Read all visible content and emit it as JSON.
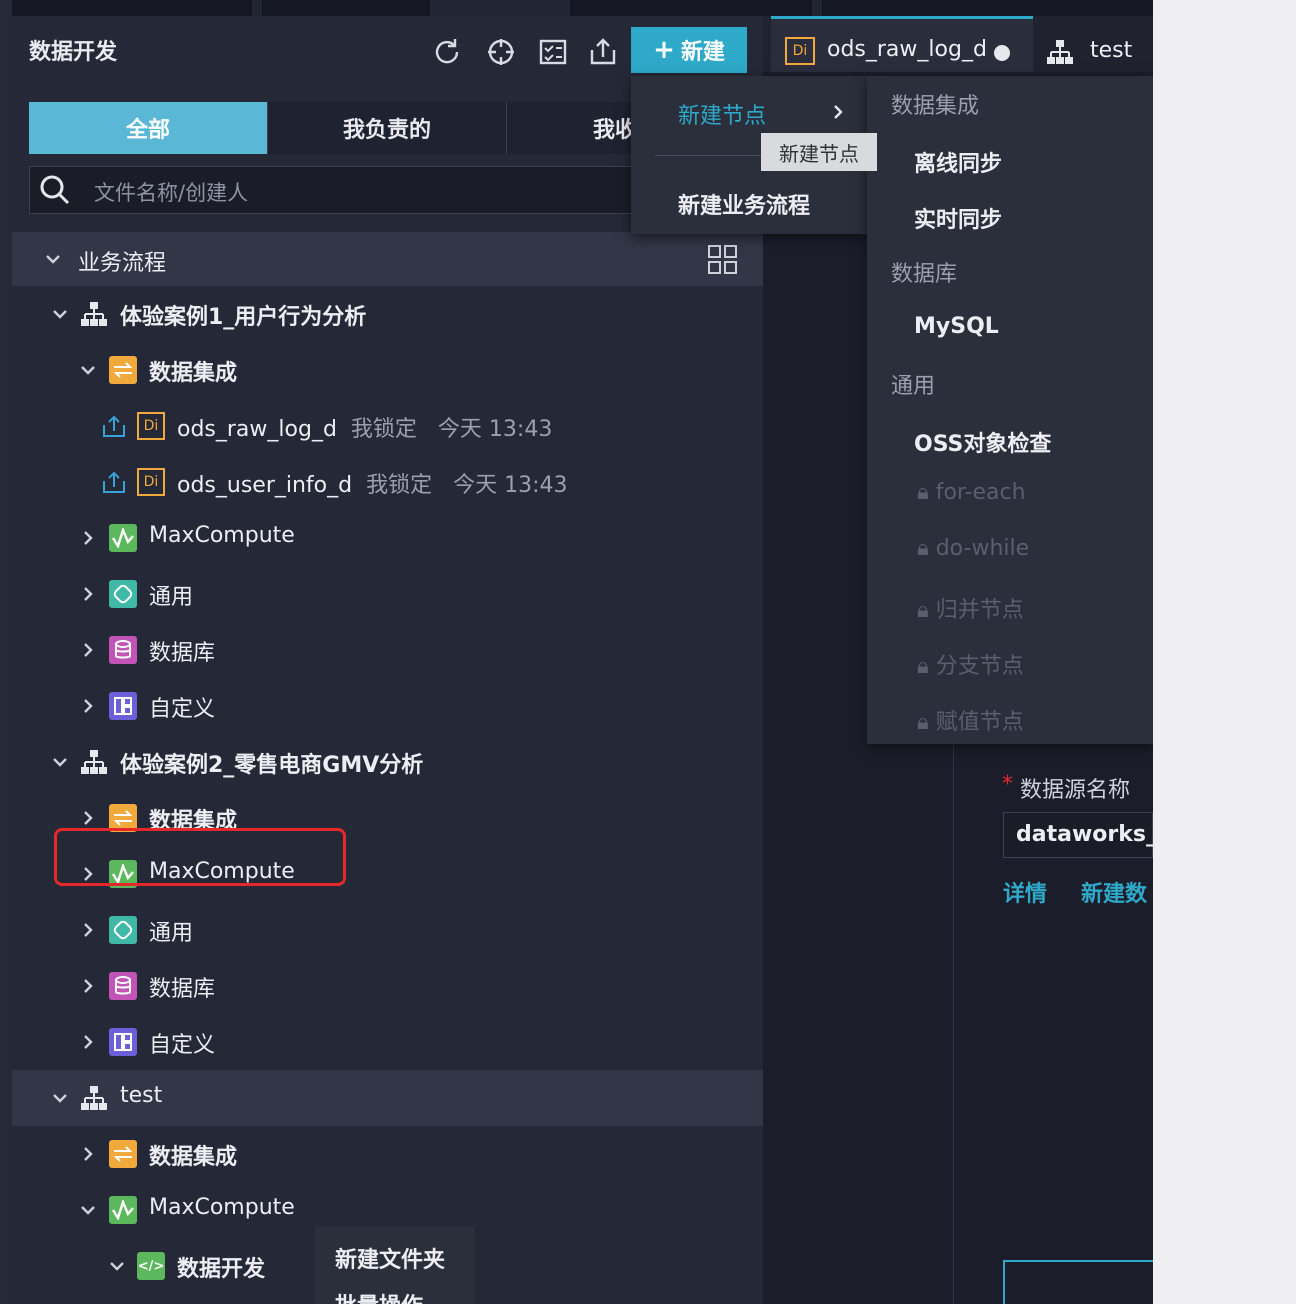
{
  "header": {
    "title": "数据开发",
    "new_label": "新建"
  },
  "tabs": [
    "全部",
    "我负责的",
    "我收藏"
  ],
  "search": {
    "placeholder": "文件名称/创建人"
  },
  "tree": {
    "section_label": "业务流程",
    "flow1": {
      "name": "体验案例1_用户行为分析",
      "integration": "数据集成",
      "files": [
        {
          "name": "ods_raw_log_d",
          "lock": "我锁定",
          "time": "今天 13:43"
        },
        {
          "name": "ods_user_info_d",
          "lock": "我锁定",
          "time": "今天 13:43"
        }
      ],
      "folders": [
        "MaxCompute",
        "通用",
        "数据库",
        "自定义"
      ]
    },
    "flow2": {
      "name": "体验案例2_零售电商GMV分析",
      "folders": [
        "数据集成",
        "MaxCompute",
        "通用",
        "数据库",
        "自定义"
      ]
    },
    "flow3": {
      "name": "test",
      "folders": [
        "数据集成",
        "MaxCompute"
      ],
      "subfolder": "数据开发"
    }
  },
  "editor_tabs": [
    {
      "name": "ods_raw_log_d",
      "badge": "Di"
    },
    {
      "name": "test"
    }
  ],
  "new_menu": {
    "new_node": "新建节点",
    "new_flow": "新建业务流程",
    "tooltip": "新建节点"
  },
  "node_menu": {
    "groups": [
      {
        "title": "数据集成",
        "items": [
          "离线同步",
          "实时同步"
        ]
      },
      {
        "title": "数据库",
        "items": [
          "MySQL"
        ]
      },
      {
        "title": "通用",
        "items": [
          "OSS对象检查"
        ]
      }
    ],
    "disabled": [
      "for-each",
      "do-while",
      "归并节点",
      "分支节点",
      "赋值节点"
    ]
  },
  "context_menu": {
    "new_folder": "新建文件夹",
    "batch": "批量操作"
  },
  "form": {
    "required_mark": "*",
    "label": "数据源名称",
    "value": "dataworks_de",
    "link_detail": "详情",
    "link_new": "新建数据源"
  },
  "colors": {
    "accent": "#2ea9c9",
    "panel": "#252836",
    "highlight_box": "#e5282c"
  }
}
